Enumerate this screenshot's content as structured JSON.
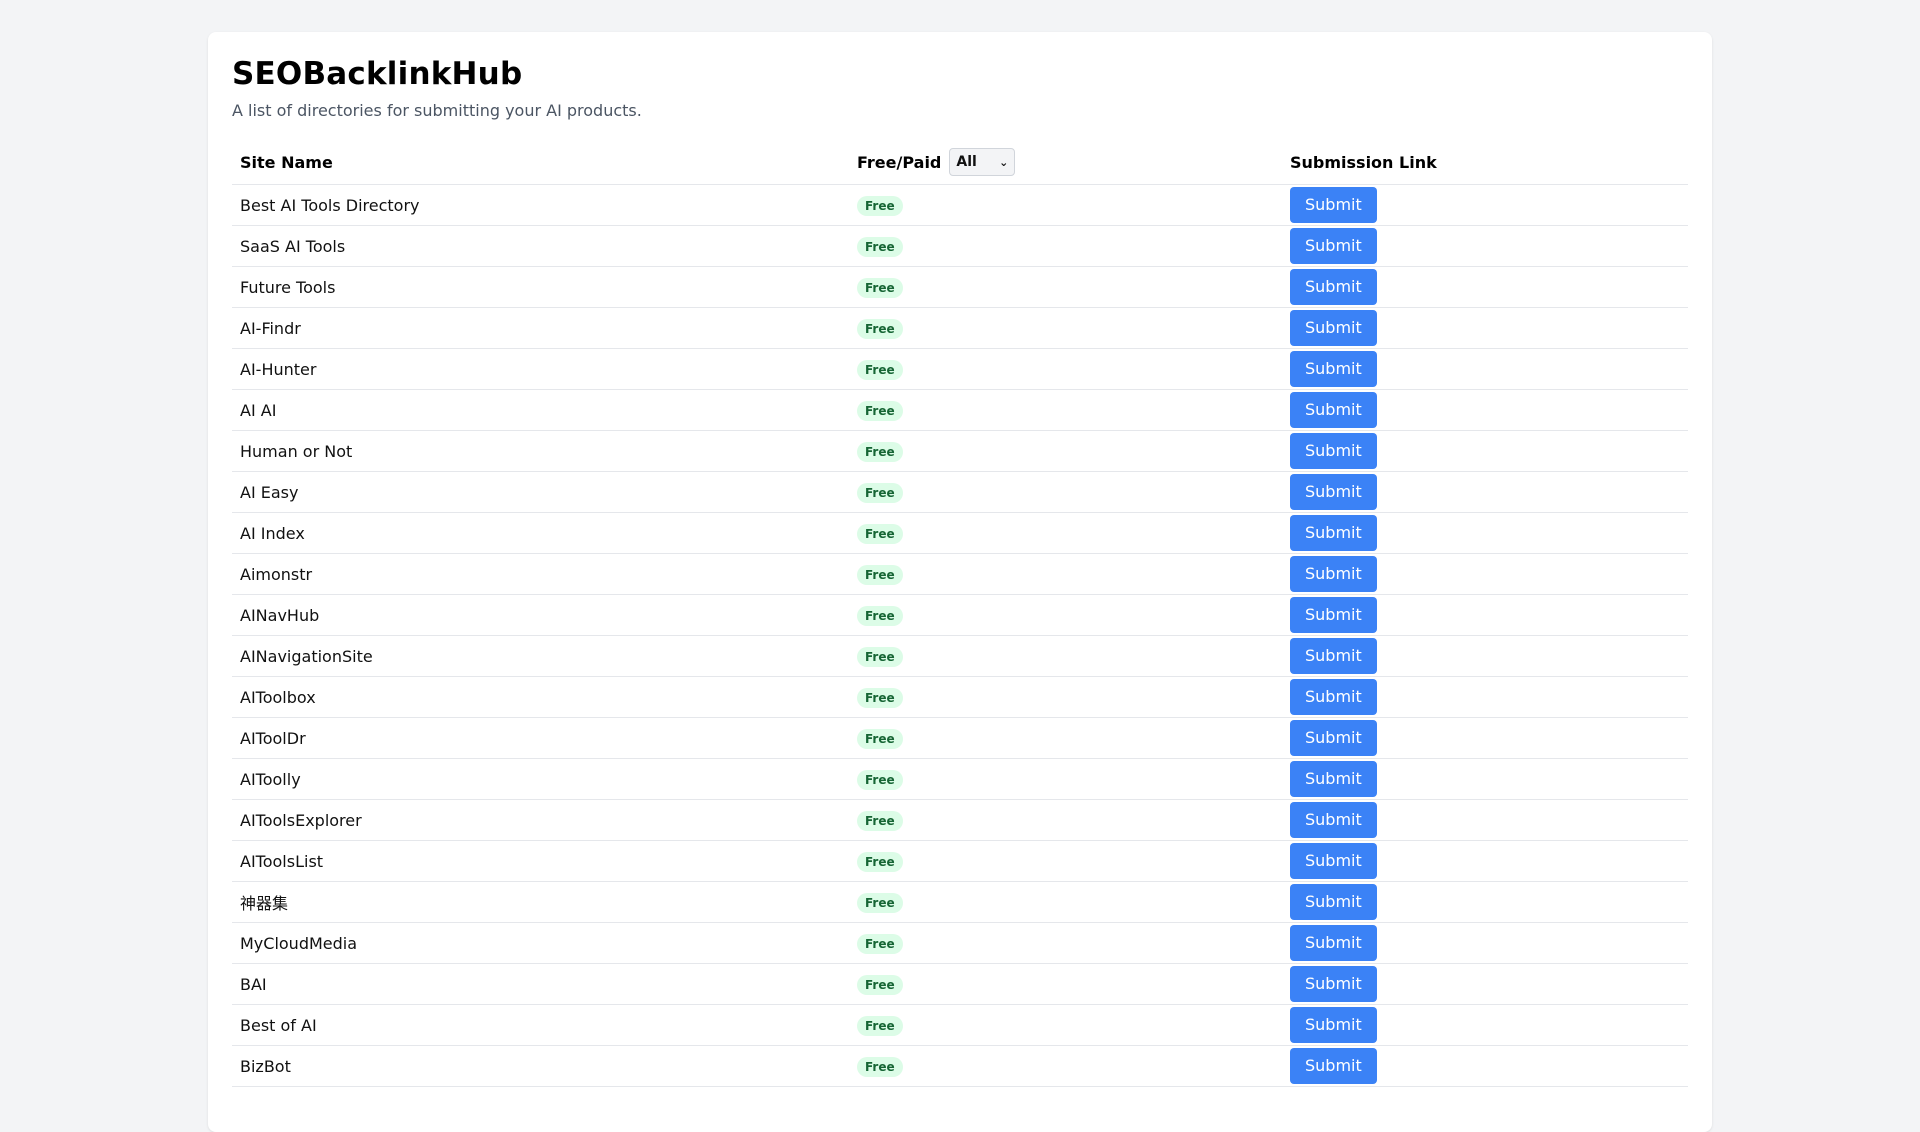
{
  "header": {
    "title": "SEOBacklinkHub",
    "subtitle": "A list of directories for submitting your AI products."
  },
  "table": {
    "columns": {
      "site_name": "Site Name",
      "free_paid": "Free/Paid",
      "submission_link": "Submission Link"
    },
    "filter": {
      "selected": "All",
      "icon": "chevron-down-icon"
    },
    "rows": [
      {
        "name": "Best AI Tools Directory",
        "pricing": "Free",
        "action": "Submit"
      },
      {
        "name": "SaaS AI Tools",
        "pricing": "Free",
        "action": "Submit"
      },
      {
        "name": "Future Tools",
        "pricing": "Free",
        "action": "Submit"
      },
      {
        "name": "AI-Findr",
        "pricing": "Free",
        "action": "Submit"
      },
      {
        "name": "AI-Hunter",
        "pricing": "Free",
        "action": "Submit"
      },
      {
        "name": "AI AI",
        "pricing": "Free",
        "action": "Submit"
      },
      {
        "name": "Human or Not",
        "pricing": "Free",
        "action": "Submit"
      },
      {
        "name": "AI Easy",
        "pricing": "Free",
        "action": "Submit"
      },
      {
        "name": "AI Index",
        "pricing": "Free",
        "action": "Submit"
      },
      {
        "name": "Aimonstr",
        "pricing": "Free",
        "action": "Submit"
      },
      {
        "name": "AINavHub",
        "pricing": "Free",
        "action": "Submit"
      },
      {
        "name": "AINavigationSite",
        "pricing": "Free",
        "action": "Submit"
      },
      {
        "name": "AIToolbox",
        "pricing": "Free",
        "action": "Submit"
      },
      {
        "name": "AIToolDr",
        "pricing": "Free",
        "action": "Submit"
      },
      {
        "name": "AIToolly",
        "pricing": "Free",
        "action": "Submit"
      },
      {
        "name": "AIToolsExplorer",
        "pricing": "Free",
        "action": "Submit"
      },
      {
        "name": "AIToolsList",
        "pricing": "Free",
        "action": "Submit"
      },
      {
        "name": "神器集",
        "pricing": "Free",
        "action": "Submit"
      },
      {
        "name": "MyCloudMedia",
        "pricing": "Free",
        "action": "Submit"
      },
      {
        "name": "BAI",
        "pricing": "Free",
        "action": "Submit"
      },
      {
        "name": "Best of AI",
        "pricing": "Free",
        "action": "Submit"
      },
      {
        "name": "BizBot",
        "pricing": "Free",
        "action": "Submit"
      }
    ]
  },
  "colors": {
    "accent": "#3b82f6",
    "badge_bg": "#dcfce7",
    "badge_text": "#166534",
    "page_bg": "#f3f4f6"
  }
}
